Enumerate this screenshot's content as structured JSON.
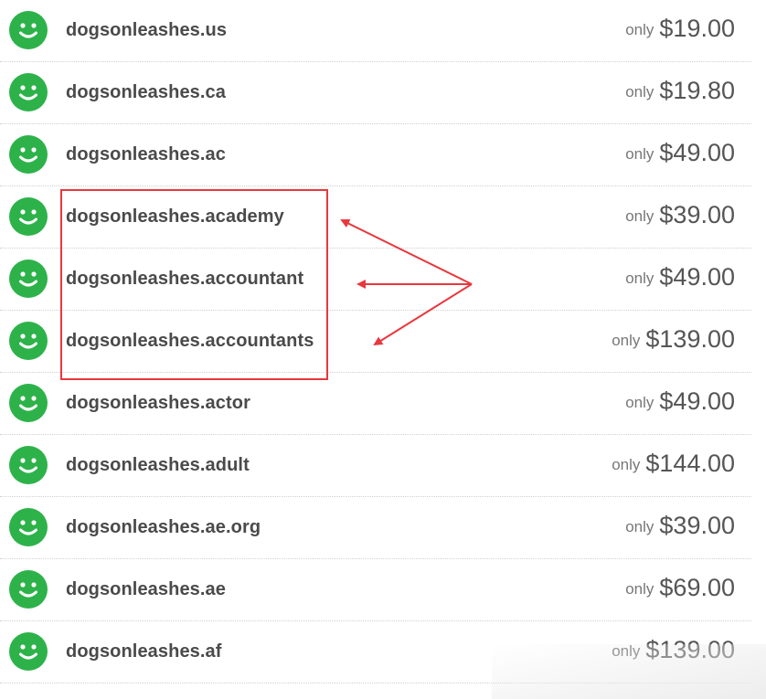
{
  "only_label": "only",
  "domains": [
    {
      "name": "dogsonleashes.us",
      "price": "$19.00"
    },
    {
      "name": "dogsonleashes.ca",
      "price": "$19.80"
    },
    {
      "name": "dogsonleashes.ac",
      "price": "$49.00"
    },
    {
      "name": "dogsonleashes.academy",
      "price": "$39.00"
    },
    {
      "name": "dogsonleashes.accountant",
      "price": "$49.00"
    },
    {
      "name": "dogsonleashes.accountants",
      "price": "$139.00"
    },
    {
      "name": "dogsonleashes.actor",
      "price": "$49.00"
    },
    {
      "name": "dogsonleashes.adult",
      "price": "$144.00"
    },
    {
      "name": "dogsonleashes.ae.org",
      "price": "$39.00"
    },
    {
      "name": "dogsonleashes.ae",
      "price": "$69.00"
    },
    {
      "name": "dogsonleashes.af",
      "price": "$139.00"
    }
  ],
  "icon": "smiley-available-icon",
  "colors": {
    "icon_green": "#2db24a",
    "annotation_red": "#e8383d",
    "domain_text": "#4a4a4a",
    "price_text": "#555555"
  }
}
